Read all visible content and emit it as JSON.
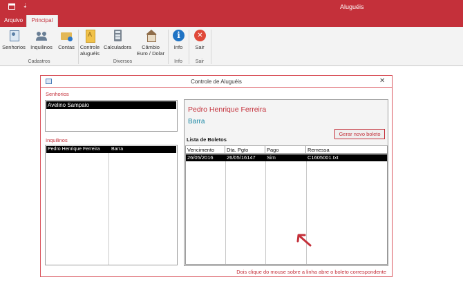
{
  "window": {
    "title": "Aluguéis"
  },
  "qat": {
    "arrow": "⇣"
  },
  "tabs": {
    "arquivo": "Arquivo",
    "principal": "Principal"
  },
  "ribbon": {
    "senhorios": "Senhorios",
    "inquilinos": "Inquilinos",
    "contas": "Contas",
    "controle_line1": "Controle",
    "controle_line2": "aluguéis",
    "calculadora": "Calculadora",
    "cambio_line1": "Câmbio",
    "cambio_line2": "Euro / Dolar",
    "info": "Info",
    "sair": "Sair",
    "groups": {
      "cadastros": "Cadastros",
      "diversos": "Diversos",
      "info": "Info",
      "sair": "Sair"
    }
  },
  "dialog": {
    "title": "Controle de Aluguéis",
    "close": "✕",
    "senhorios_label": "Senhorios",
    "inquilinos_label": "Inquilinos",
    "senhorio_selected": "Avelino Sampaio",
    "inquilino_row": {
      "name": "Pedro Henrique Ferreira",
      "location": "Barra"
    },
    "tenant_name": "Pedro Henrique Ferreira",
    "tenant_location": "Barra",
    "new_boleto_button": "Gerar novo boleto",
    "boletos_title": "Lista de Boletos",
    "boletos_columns": [
      "Vencimento",
      "Dta. Pgto",
      "Pago",
      "Remessa"
    ],
    "boleto_row": {
      "vencimento": "26/05/2016",
      "dta_pgto": "26/05/16147",
      "pago": "Sim",
      "remessa": "C1605001.txt"
    },
    "footer_note": "Dois clique do mouse sobre a linha abre o boleto correspondente"
  },
  "colors": {
    "accent": "#c4303a",
    "teal": "#1f8aa6",
    "selection": "#000000"
  }
}
